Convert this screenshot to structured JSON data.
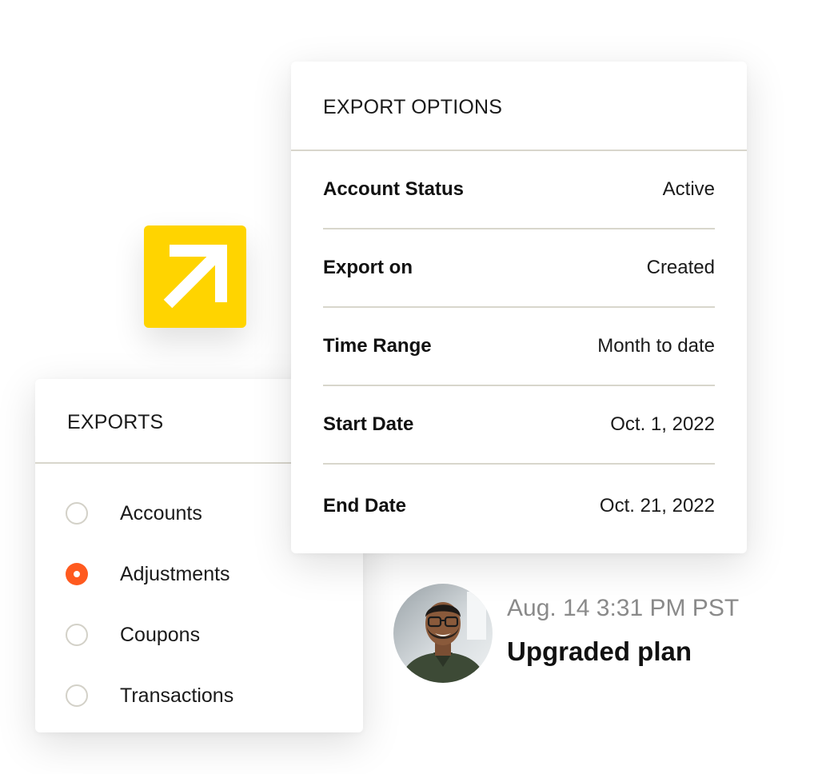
{
  "export_options": {
    "title": "EXPORT OPTIONS",
    "rows": [
      {
        "label": "Account Status",
        "value": "Active"
      },
      {
        "label": "Export on",
        "value": "Created"
      },
      {
        "label": "Time Range",
        "value": "Month to date"
      },
      {
        "label": "Start Date",
        "value": "Oct. 1, 2022"
      },
      {
        "label": "End Date",
        "value": "Oct. 21, 2022"
      }
    ]
  },
  "exports": {
    "title": "EXPORTS",
    "selected": "Adjustments",
    "items": [
      {
        "label": "Accounts",
        "checked": false
      },
      {
        "label": "Adjustments",
        "checked": true
      },
      {
        "label": "Coupons",
        "checked": false
      },
      {
        "label": "Transactions",
        "checked": false
      }
    ]
  },
  "activity": {
    "timestamp": "Aug. 14 3:31 PM PST",
    "event": "Upgraded plan"
  },
  "icons": {
    "arrow_tile": "arrow-up-right-icon",
    "avatar": "user-avatar"
  },
  "colors": {
    "accent_yellow": "#FFD400",
    "radio_checked": "#FF5A1F",
    "divider": "#d8d6cc",
    "timestamp_gray": "#8a8a8a"
  }
}
